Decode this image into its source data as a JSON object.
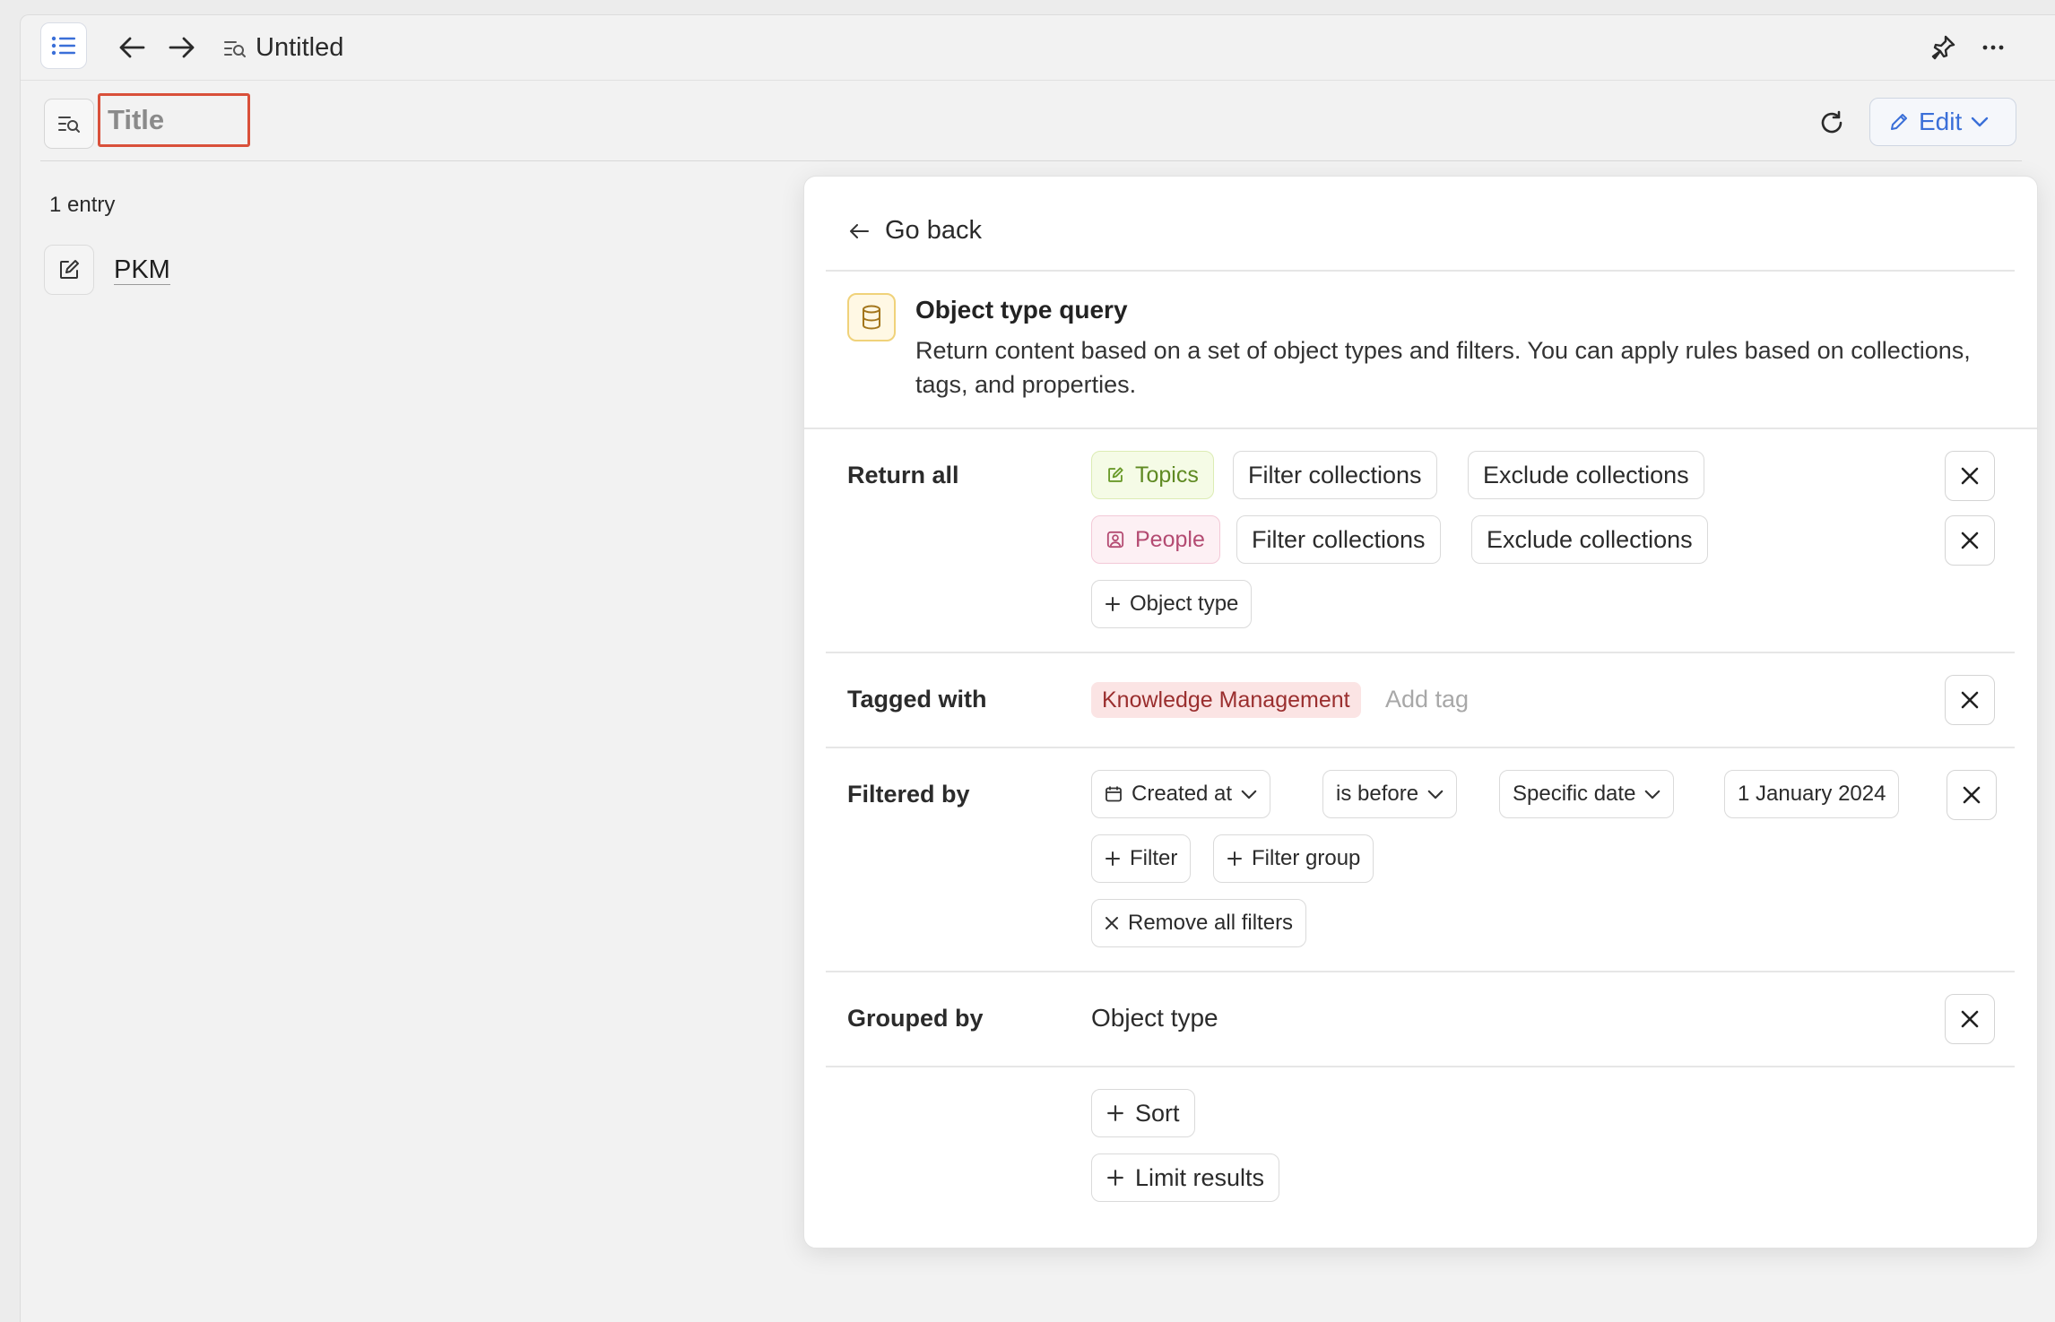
{
  "topbar": {
    "title": "Untitled"
  },
  "toolbar": {
    "title_placeholder": "Title",
    "edit_label": "Edit"
  },
  "list": {
    "count": "1 entry",
    "items": [
      {
        "label": "PKM"
      }
    ]
  },
  "panel": {
    "go_back": "Go back",
    "query_title": "Object type query",
    "query_desc": "Return content based on a set of object types and filters. You can apply rules based on collections, tags, and properties.",
    "return_all": {
      "label": "Return all",
      "types": [
        {
          "name": "Topics",
          "filter": "Filter collections",
          "exclude": "Exclude collections"
        },
        {
          "name": "People",
          "filter": "Filter collections",
          "exclude": "Exclude collections"
        }
      ],
      "add_type": "Object type"
    },
    "tagged_with": {
      "label": "Tagged with",
      "tag": "Knowledge Management",
      "add_tag": "Add tag"
    },
    "filtered_by": {
      "label": "Filtered by",
      "field": "Created at",
      "operator": "is before",
      "mode": "Specific date",
      "value": "1 January 2024",
      "add_filter": "Filter",
      "add_group": "Filter group",
      "remove_all": "Remove all filters"
    },
    "grouped_by": {
      "label": "Grouped by",
      "value": "Object type"
    },
    "sort": "Sort",
    "limit": "Limit results"
  },
  "colors": {
    "accent": "#3a6fd8",
    "title_highlight": "#d9503a",
    "topics": "#5f8a22",
    "people": "#b44b72",
    "tag": "#9a2e2e"
  }
}
